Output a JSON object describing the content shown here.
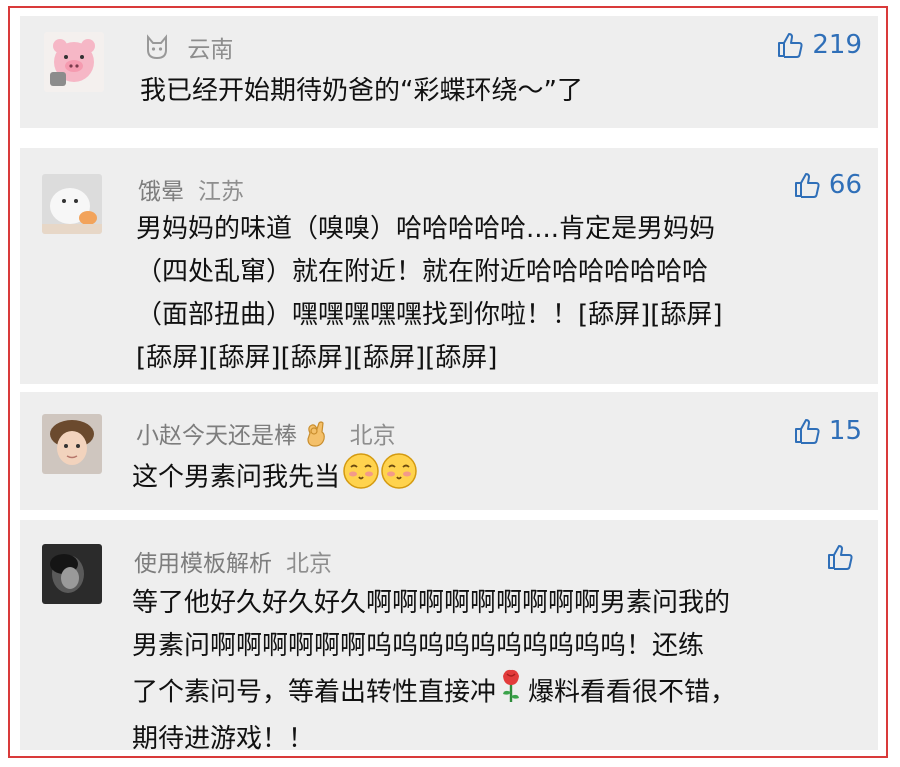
{
  "comments": [
    {
      "user": "",
      "location": "云南",
      "likes": "219",
      "lines": [
        "我已经开始期待奶爸的“彩蝶环绕～”了"
      ]
    },
    {
      "user": "饿晕",
      "location": "江苏",
      "likes": "66",
      "lines": [
        "男妈妈的味道（嗅嗅）哈哈哈哈哈....肯定是男妈妈",
        "（四处乱窜）就在附近！就在附近哈哈哈哈哈哈哈",
        "（面部扭曲）嘿嘿嘿嘿嘿找到你啦！！[舔屏][舔屏]",
        "[舔屏][舔屏][舔屏][舔屏][舔屏]"
      ]
    },
    {
      "user": "小赵今天还是棒",
      "location": "北京",
      "likes": "15",
      "lines": [
        "这个男素问我先当"
      ]
    },
    {
      "user": "使用模板解析",
      "location": "北京",
      "likes": "",
      "lines": [
        "等了他好久好久好久啊啊啊啊啊啊啊啊啊男素问我的",
        "男素问啊啊啊啊啊啊呜呜呜呜呜呜呜呜呜呜！还练",
        "了个素问号，等着出转性直接冲",
        "爆料看看很不错，",
        "期待进游戏！！"
      ]
    }
  ],
  "colors": {
    "frame_border": "#d93a3a",
    "card_bg": "#eeeeee",
    "like_blue": "#2f6fb8",
    "username_gray": "#7d7d7d"
  },
  "icons": {
    "user1_badge": "cat-badge-icon",
    "like": "thumbs-up-icon",
    "emoji_ok": "ok-hand-emoji",
    "emoji_blush": "blushing-face-emoji",
    "emoji_rose": "rose-emoji"
  }
}
